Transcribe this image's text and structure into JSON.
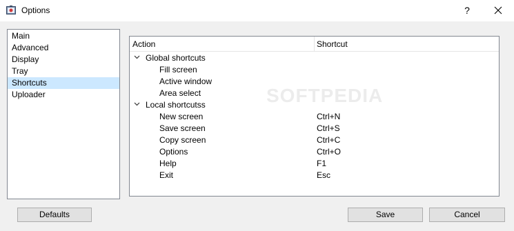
{
  "window": {
    "title": "Options",
    "help_label": "?"
  },
  "nav": {
    "items": [
      {
        "label": "Main"
      },
      {
        "label": "Advanced"
      },
      {
        "label": "Display"
      },
      {
        "label": "Tray"
      },
      {
        "label": "Shortcuts",
        "selected": true
      },
      {
        "label": "Uploader"
      }
    ]
  },
  "shortcuts": {
    "columns": {
      "action": "Action",
      "shortcut": "Shortcut"
    },
    "groups": [
      {
        "label": "Global shortcuts",
        "items": [
          {
            "action": "Fill screen",
            "shortcut": ""
          },
          {
            "action": "Active window",
            "shortcut": ""
          },
          {
            "action": "Area select",
            "shortcut": ""
          }
        ]
      },
      {
        "label": "Local shortcutss",
        "items": [
          {
            "action": "New screen",
            "shortcut": "Ctrl+N"
          },
          {
            "action": "Save screen",
            "shortcut": "Ctrl+S"
          },
          {
            "action": "Copy screen",
            "shortcut": "Ctrl+C"
          },
          {
            "action": "Options",
            "shortcut": "Ctrl+O"
          },
          {
            "action": "Help",
            "shortcut": "F1"
          },
          {
            "action": "Exit",
            "shortcut": "Esc"
          }
        ]
      }
    ],
    "watermark": "SOFTPEDIA"
  },
  "buttons": {
    "defaults": "Defaults",
    "save": "Save",
    "cancel": "Cancel"
  },
  "colors": {
    "selection": "#cce8ff",
    "background": "#f0f0f0"
  }
}
